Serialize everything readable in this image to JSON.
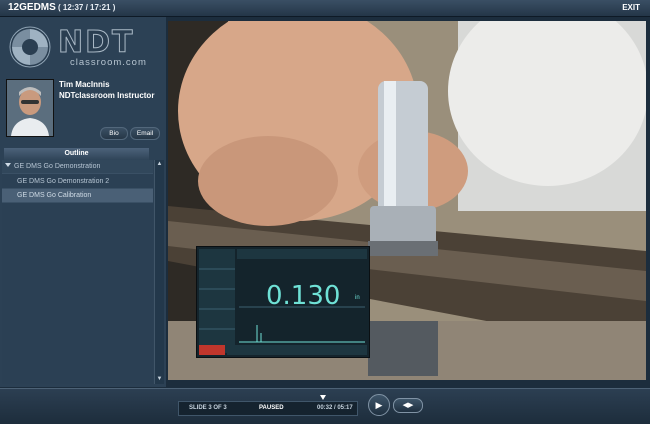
{
  "header": {
    "course_title": "12GEDMS",
    "time_readout": "( 12:37 / 17:21 )",
    "exit_label": "EXIT"
  },
  "logo": {
    "wordmark": "NDT",
    "subtitle": "classroom.com"
  },
  "instructor": {
    "name": "Tim MacInnis",
    "role": "NDTclassroom Instructor",
    "bio_label": "Bio",
    "email_label": "Email"
  },
  "outline": {
    "tab_label": "Outline",
    "items": [
      {
        "label": "GE DMS Go Demonstration",
        "expanded_icon": "triangle-down-icon"
      },
      {
        "label": "GE DMS Go Demonstration 2"
      },
      {
        "label": "GE DMS Go Calibration"
      }
    ]
  },
  "video": {
    "screen_reading": "0.130",
    "screen_unit": "in"
  },
  "player": {
    "slide_counter": "SLIDE 3 OF 3",
    "play_state": "PAUSED",
    "progress_time": "00:32 / 05:17",
    "play_icon": "play-icon",
    "prev_icon": "previous-icon",
    "next_icon": "next-icon"
  },
  "colors": {
    "background": "#1c2d3d",
    "sidebar": "#2c4155",
    "screen_text": "#6fe1d6"
  }
}
